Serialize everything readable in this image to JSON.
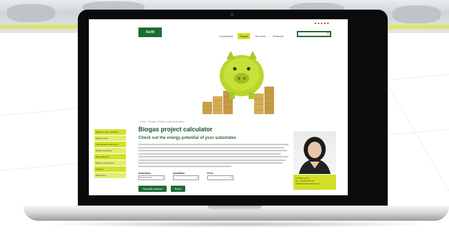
{
  "colors": {
    "accent": "#d3e027",
    "brand": "#1f6b34"
  },
  "site": {
    "flags": "■ ■ ■ ■ ■",
    "logo_text": "fucht",
    "nav": [
      {
        "label": "Companies",
        "active": false
      },
      {
        "label": "Biogas",
        "active": true
      },
      {
        "label": "Services",
        "active": false
      },
      {
        "label": "Products",
        "active": false
      }
    ],
    "search_placeholder": "",
    "breadcrumb": "› Home › Biogas › Biogas project calculator",
    "title": "Biogas project calculator",
    "subtitle": "Check out the energy potential of your substrates",
    "side_menu": [
      "Biogas project calculator",
      "Biogas plants",
      "Fermentation technology",
      "Biogas upgrading",
      "Gas treatment",
      "Biogas components",
      "Fertiliser",
      "References"
    ],
    "contact": {
      "lines": [
        "Contact person",
        "Tel. +49 000 000 00",
        "info@example-biogas.com"
      ]
    },
    "form": {
      "fields": [
        {
          "label": "Substrates",
          "value": "Please select"
        },
        {
          "label": "Quantities",
          "value": ""
        },
        {
          "label": "Price",
          "value": ""
        }
      ]
    },
    "buttons": [
      {
        "label": "Calculate potential"
      },
      {
        "label": "Reset"
      }
    ]
  }
}
